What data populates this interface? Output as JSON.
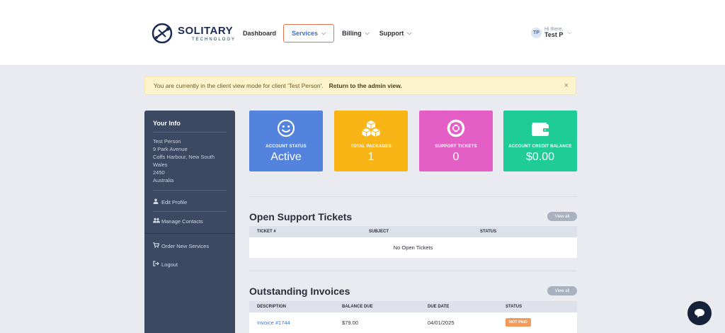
{
  "brand": {
    "name": "SOLITARY",
    "sub": "TECHNOLOGY"
  },
  "nav": {
    "items": [
      {
        "label": "Dashboard",
        "has_menu": false,
        "active": false
      },
      {
        "label": "Services",
        "has_menu": true,
        "active": true
      },
      {
        "label": "Billing",
        "has_menu": true,
        "active": false
      },
      {
        "label": "Support",
        "has_menu": true,
        "active": false
      }
    ]
  },
  "user": {
    "initials": "TP",
    "greeting": "Hi there,",
    "name": "Test P"
  },
  "alert": {
    "text": "You are currently in the client view mode for client 'Test Person'.",
    "link": "Return to the admin view.",
    "close": "×"
  },
  "sidebar": {
    "title": "Your Info",
    "address": [
      "Test Person",
      "9 Park Avenue",
      "Coffs Harbour, New South",
      "Wales",
      "2450",
      "Australia"
    ],
    "links": {
      "edit_profile": "Edit Profile",
      "manage_contacts": "Manage Contacts",
      "order_services": "Order New Services",
      "logout": "Logout"
    }
  },
  "stats": [
    {
      "label": "ACCOUNT STATUS",
      "value": "Active",
      "icon": "smile-icon",
      "color": "#5383dd"
    },
    {
      "label": "TOTAL PACKAGES",
      "value": "1",
      "icon": "cubes-icon",
      "color": "#f8b515"
    },
    {
      "label": "SUPPORT TICKETS",
      "value": "0",
      "icon": "lifebuoy-icon",
      "color": "#e35fc6"
    },
    {
      "label": "ACCOUNT CREDIT BALANCE",
      "value": "$0.00",
      "icon": "wallet-icon",
      "color": "#1fcc95"
    }
  ],
  "tickets": {
    "title": "Open Support Tickets",
    "view_all": "View all",
    "columns": [
      "TICKET #",
      "SUBJECT",
      "STATUS"
    ],
    "empty": "No Open Tickets"
  },
  "invoices": {
    "title": "Outstanding Invoices",
    "view_all": "View all",
    "columns": [
      "DESCRIPTION",
      "BALANCE DUE",
      "DUE DATE",
      "STATUS"
    ],
    "rows": [
      {
        "description": "Invoice #1744",
        "balance": "$79.00",
        "due": "04/01/2025",
        "status": "NOT PAID"
      }
    ]
  }
}
